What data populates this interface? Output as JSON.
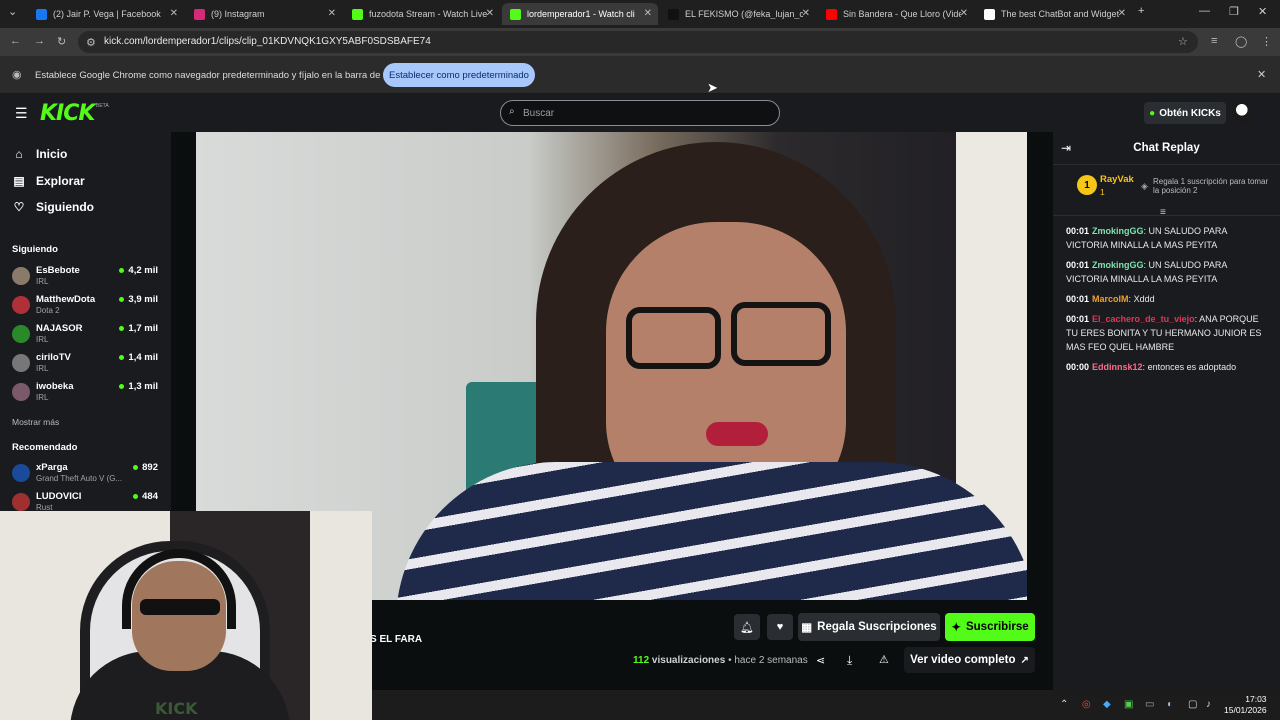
{
  "browser": {
    "tabs": [
      {
        "label": "(2) Jair P. Vega | Facebook",
        "fav_color": "#1877f2",
        "active": false
      },
      {
        "label": "(9) Instagram",
        "fav_color": "#d62976",
        "active": false
      },
      {
        "label": "fuzodota Stream - Watch Live o",
        "fav_color": "#53fc18",
        "active": false
      },
      {
        "label": "lordemperador1 - Watch cli",
        "fav_color": "#53fc18",
        "active": true
      },
      {
        "label": "EL FEKISMO (@feka_lujan_carri",
        "fav_color": "#111111",
        "active": false
      },
      {
        "label": "Sin Bandera - Que Lloro (Video",
        "fav_color": "#ff0000",
        "active": false
      },
      {
        "label": "The best ChatBot and Widgets",
        "fav_color": "#ffffff",
        "active": false
      }
    ],
    "url": "kick.com/lordemperador1/clips/clip_01KDVNQK1GXY5ABF0SDSBAFE74",
    "infobar": {
      "text": "Establece Google Chrome como navegador predeterminado y fíjalo en la barra de tareas",
      "button": "Establecer como predeterminado"
    }
  },
  "kick": {
    "logo": "KICK",
    "logo_badge": "BETA",
    "search_placeholder": "Buscar",
    "kicks_button": "Obtén KICKs",
    "nav": [
      {
        "label": "Inicio",
        "icon": "home-icon"
      },
      {
        "label": "Explorar",
        "icon": "compass-icon"
      },
      {
        "label": "Siguiendo",
        "icon": "heart-icon"
      }
    ],
    "following_title": "Siguiendo",
    "following": [
      {
        "name": "EsBebote",
        "category": "IRL",
        "viewers": "4,2 mil",
        "color": "#8a7a6a"
      },
      {
        "name": "MatthewDota",
        "category": "Dota 2",
        "viewers": "3,9 mil",
        "color": "#b0303a"
      },
      {
        "name": "NAJASOR",
        "category": "IRL",
        "viewers": "1,7 mil",
        "color": "#2a8a2a"
      },
      {
        "name": "ciriloTV",
        "category": "IRL",
        "viewers": "1,4 mil",
        "color": "#777777"
      },
      {
        "name": "iwobeka",
        "category": "IRL",
        "viewers": "1,3 mil",
        "color": "#7a5a6a"
      }
    ],
    "show_more": "Mostrar más",
    "recommended_title": "Recomendado",
    "recommended": [
      {
        "name": "xParga",
        "category": "Grand Theft Auto V (G...",
        "viewers": "892",
        "color": "#1a4a9a"
      },
      {
        "name": "LUDOVICI",
        "category": "Rust",
        "viewers": "484",
        "color": "#a03030"
      }
    ],
    "clip": {
      "title_fragment": "S EL FARA",
      "gift_button": "Regala Suscripciones",
      "subscribe_button": "Suscribirse",
      "views_count": "112",
      "views_label": "visualizaciones",
      "time_ago": "hace 2 semanas",
      "full_video_button": "Ver video completo"
    },
    "chat": {
      "title": "Chat Replay",
      "top_gifter": {
        "rank": "1",
        "name": "RayVak",
        "count": "1",
        "info": "Regala 1 suscripción para tomar la posición 2"
      },
      "messages": [
        {
          "time": "00:01",
          "user": "ZmokingGG",
          "user_color": "#7ee3b0",
          "text": "UN SALUDO PARA VICTORIA MINALLA LA MAS PEYITA"
        },
        {
          "time": "00:01",
          "user": "ZmokingGG",
          "user_color": "#7ee3b0",
          "text": "UN SALUDO PARA VICTORIA MINALLA LA MAS PEYITA"
        },
        {
          "time": "00:01",
          "user": "MarcolM",
          "user_color": "#f0a030",
          "text": "Xddd"
        },
        {
          "time": "00:01",
          "user": "El_cachero_de_tu_viejo",
          "user_color": "#e0365a",
          "text": "ANA PORQUE TU ERES BONITA Y TU HERMANO JUNIOR ES MAS FEO QUEL HAMBRE"
        },
        {
          "time": "00:00",
          "user": "Eddinnsk12",
          "user_color": "#ff6b8a",
          "text": "entonces es adoptado"
        }
      ]
    }
  },
  "cam": {
    "shirt_text": "KICK"
  },
  "taskbar": {
    "time": "17:03",
    "date": "15/01/2026"
  }
}
